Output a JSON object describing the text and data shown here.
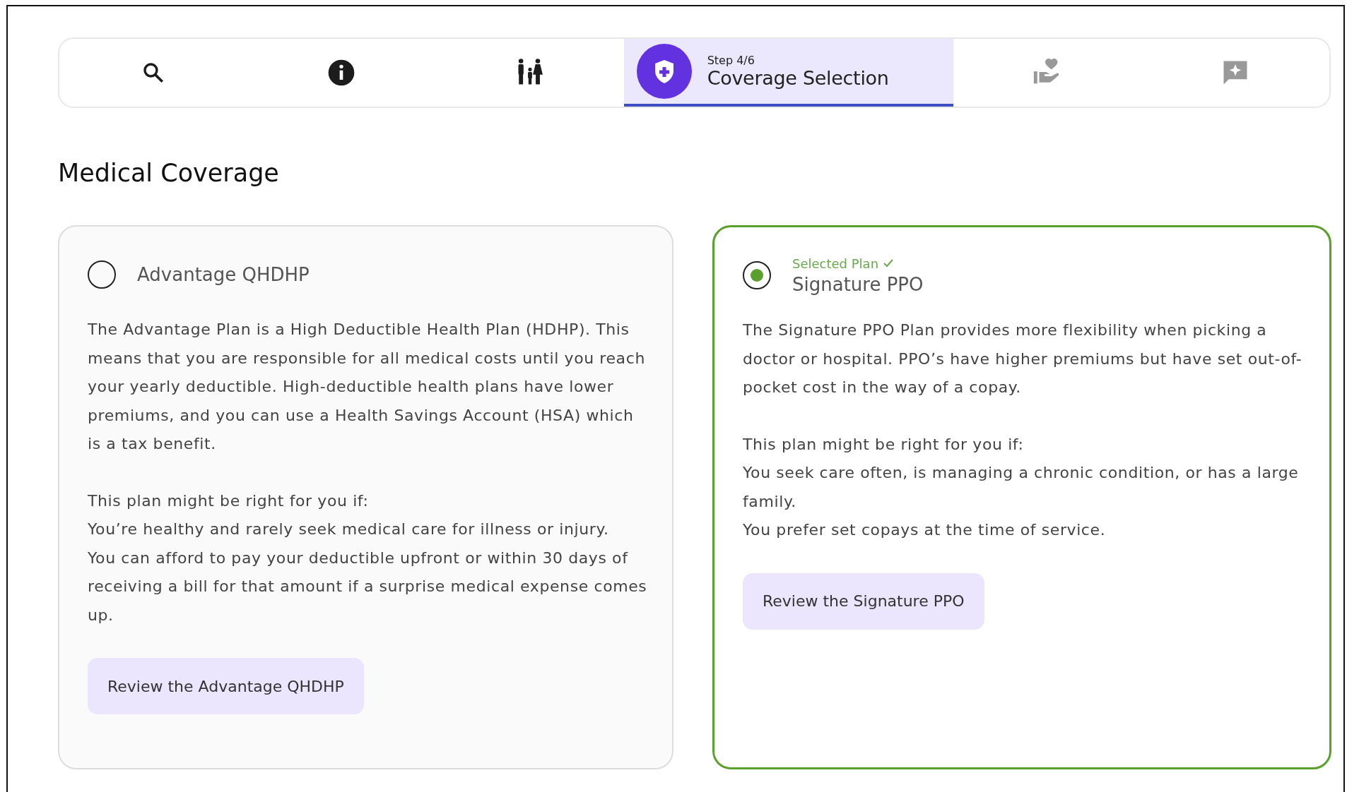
{
  "steps": [
    {
      "kind": "search",
      "completed": true,
      "selected": false
    },
    {
      "kind": "info",
      "completed": true,
      "selected": false
    },
    {
      "kind": "family",
      "completed": true,
      "selected": false
    },
    {
      "kind": "shield",
      "completed": false,
      "selected": true,
      "step_label": "Step 4/6",
      "title": "Coverage Selection"
    },
    {
      "kind": "hand-heart",
      "completed": false,
      "selected": false
    },
    {
      "kind": "chat-star",
      "completed": false,
      "selected": false
    }
  ],
  "heading": "Medical Coverage",
  "plans": [
    {
      "name": "Advantage QHDHP",
      "selected": false,
      "description": "The Advantage Plan is a High Deductible Health Plan (HDHP). This means that you are responsible for all medical costs until you reach your yearly deductible. High-deductible health plans have lower premiums, and you can use a Health Savings Account (HSA) which is a tax benefit.",
      "fit_intro": "This plan might be right for you if:",
      "reasons": [
        "You’re healthy and rarely seek medical care for illness or injury.",
        "You can afford to pay your deductible upfront or within 30 days of receiving a bill for that amount if a surprise medical expense comes up."
      ],
      "button": "Review the Advantage QHDHP"
    },
    {
      "name": "Signature PPO",
      "selected": true,
      "selected_label": "Selected Plan",
      "description": "The Signature PPO Plan provides more flexibility when picking a doctor or hospital. PPO’s have higher premiums but have set out-of-pocket cost in the way of a copay.",
      "fit_intro": "This plan might be right for you if:",
      "reasons": [
        "You seek care often, is managing a chronic condition, or has a large family.",
        "You prefer set copays at the time of service."
      ],
      "button": "Review the Signature PPO"
    }
  ]
}
